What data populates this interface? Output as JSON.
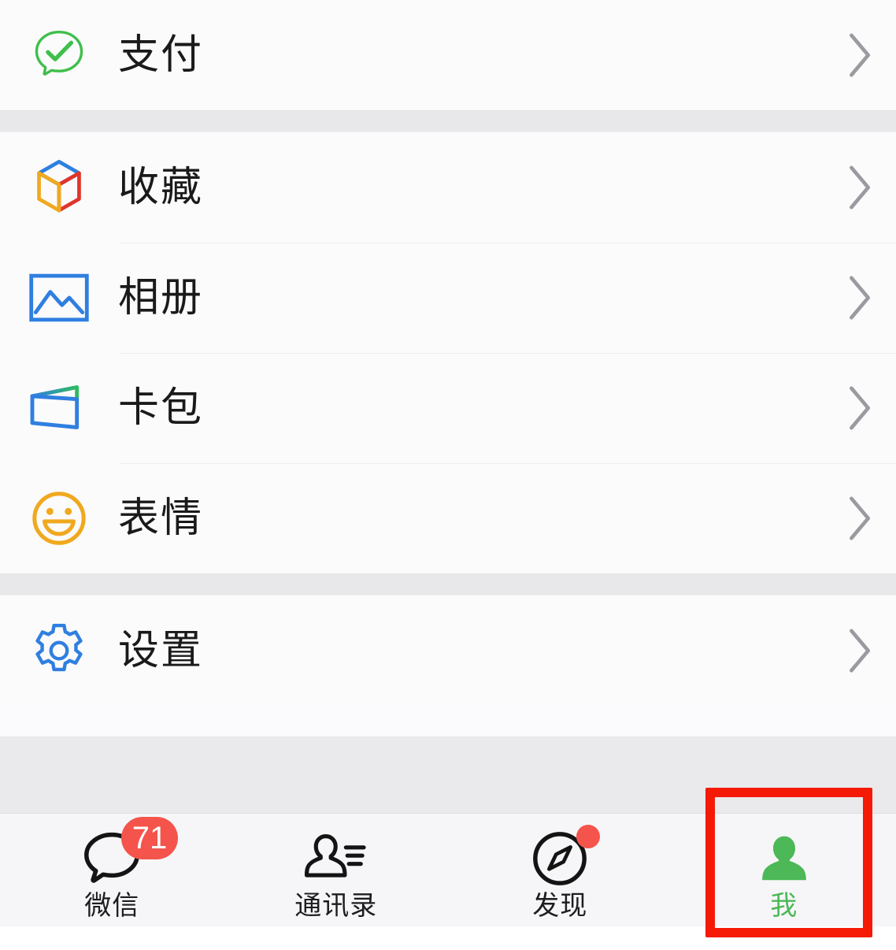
{
  "app": {
    "name": "微信",
    "screen": "我"
  },
  "colors": {
    "page_background": "#fbfbfc",
    "separator_band": "#e8e8ea",
    "row_divider": "#ededf0",
    "tabbar_background": "#f6f6f8",
    "active_tab": "#4cb857",
    "badge_red": "#f4544b",
    "annotation_red": "#f41a06",
    "label_text": "#1a1a1a",
    "chevron": "#9a9aa0"
  },
  "sections": [
    {
      "id": "pay-section",
      "rows": [
        {
          "id": "pay",
          "label": "支付",
          "icon": "wechat-pay-icon",
          "chevron": "chevron-right-icon"
        }
      ]
    },
    {
      "id": "content-section",
      "rows": [
        {
          "id": "favorites",
          "label": "收藏",
          "icon": "cube-favorites-icon",
          "chevron": "chevron-right-icon"
        },
        {
          "id": "album",
          "label": "相册",
          "icon": "photo-album-icon",
          "chevron": "chevron-right-icon"
        },
        {
          "id": "cards",
          "label": "卡包",
          "icon": "card-wallet-icon",
          "chevron": "chevron-right-icon"
        },
        {
          "id": "stickers",
          "label": "表情",
          "icon": "smiley-sticker-icon",
          "chevron": "chevron-right-icon"
        }
      ]
    },
    {
      "id": "settings-section",
      "rows": [
        {
          "id": "settings",
          "label": "设置",
          "icon": "gear-settings-icon",
          "chevron": "chevron-right-icon"
        }
      ]
    }
  ],
  "tabbar": {
    "tabs": [
      {
        "id": "chats",
        "label": "微信",
        "icon": "chat-bubble-icon",
        "active": false,
        "badge": {
          "type": "count",
          "value": "71"
        }
      },
      {
        "id": "contacts",
        "label": "通讯录",
        "icon": "contacts-person-icon",
        "active": false,
        "badge": null
      },
      {
        "id": "discover",
        "label": "发现",
        "icon": "compass-discover-icon",
        "active": false,
        "badge": {
          "type": "dot",
          "value": ""
        }
      },
      {
        "id": "me",
        "label": "我",
        "icon": "person-filled-icon",
        "active": true,
        "badge": null
      }
    ]
  },
  "annotation": {
    "id": "me-tab-highlight",
    "shape": "rectangle",
    "color": "#f41a06",
    "target": "我"
  }
}
